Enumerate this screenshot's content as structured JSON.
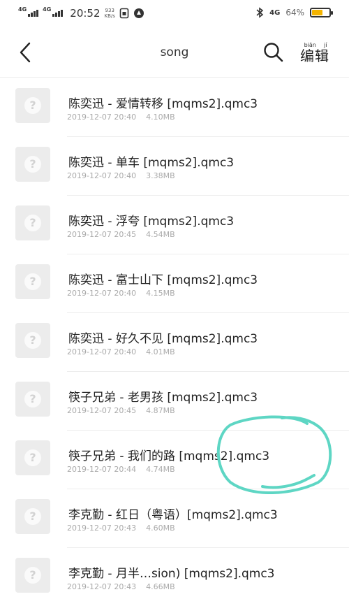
{
  "status_bar": {
    "network1": "4G",
    "network2": "4G",
    "time": "20:52",
    "speed_value": "933",
    "speed_unit": "KB/s",
    "network3": "4G",
    "battery": "64%",
    "battery_level": 0.64,
    "battery_color": "#f4b400"
  },
  "header": {
    "title": "song",
    "edit_label": "编辑",
    "edit_pinyin": [
      "biān",
      "jí"
    ],
    "back_icon": "chevron-left-icon",
    "search_icon": "search-icon"
  },
  "files": [
    {
      "name": "陈奕迅 - 爱情转移 [mqms2].qmc3",
      "date": "2019-12-07 20:40",
      "size": "4.10MB"
    },
    {
      "name": "陈奕迅 - 单车 [mqms2].qmc3",
      "date": "2019-12-07 20:40",
      "size": "3.38MB"
    },
    {
      "name": "陈奕迅 - 浮夸 [mqms2].qmc3",
      "date": "2019-12-07 20:45",
      "size": "4.54MB"
    },
    {
      "name": "陈奕迅 - 富士山下 [mqms2].qmc3",
      "date": "2019-12-07 20:40",
      "size": "4.15MB"
    },
    {
      "name": "陈奕迅 - 好久不见 [mqms2].qmc3",
      "date": "2019-12-07 20:40",
      "size": "4.01MB"
    },
    {
      "name": "筷子兄弟 - 老男孩 [mqms2].qmc3",
      "date": "2019-12-07 20:45",
      "size": "4.87MB"
    },
    {
      "name": "筷子兄弟 - 我们的路 [mqms2].qmc3",
      "date": "2019-12-07 20:44",
      "size": "4.74MB"
    },
    {
      "name": "李克勤 - 红日（粤语）[mqms2].qmc3",
      "date": "2019-12-07 20:43",
      "size": "4.60MB"
    },
    {
      "name": "李克勤 - 月半…sion) [mqms2].qmc3",
      "date": "2019-12-07 20:43",
      "size": "4.66MB"
    }
  ],
  "thumbnail_icon": "question-mark-icon",
  "annotation_color": "#5ed6c4"
}
